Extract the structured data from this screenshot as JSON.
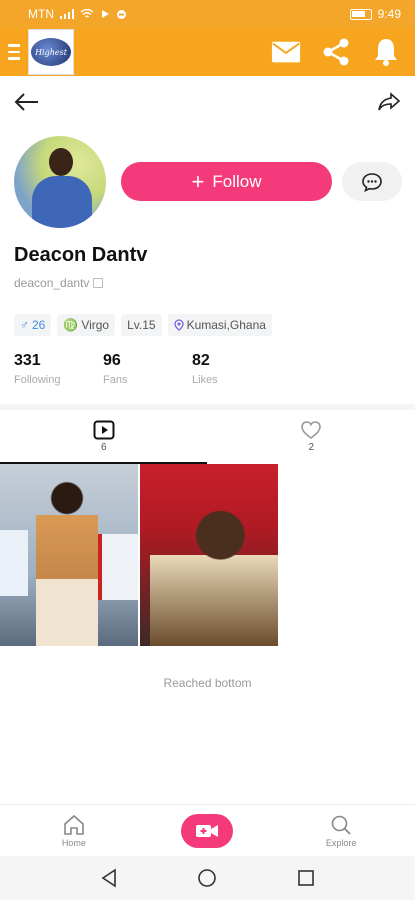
{
  "status_bar": {
    "carrier": "MTN",
    "time": "9:49"
  },
  "app_bar": {
    "logo_text": "Highest"
  },
  "profile": {
    "display_name": "Deacon Dantv",
    "handle": "deacon_dantv",
    "follow_label": "Follow",
    "tags": {
      "age": "26",
      "zodiac": "Virgo",
      "level": "Lv.15",
      "location": "Kumasi,Ghana"
    },
    "stats": [
      {
        "value": "331",
        "label": "Following"
      },
      {
        "value": "96",
        "label": "Fans"
      },
      {
        "value": "82",
        "label": "Likes"
      }
    ]
  },
  "tabs": {
    "videos_count": "6",
    "likes_count": "2"
  },
  "feed": {
    "end_text": "Reached bottom"
  },
  "bottom_nav": {
    "home_label": "Home",
    "explore_label": "Explore"
  },
  "colors": {
    "brand_orange": "#f7a51f",
    "accent_pink": "#f43a7a"
  }
}
